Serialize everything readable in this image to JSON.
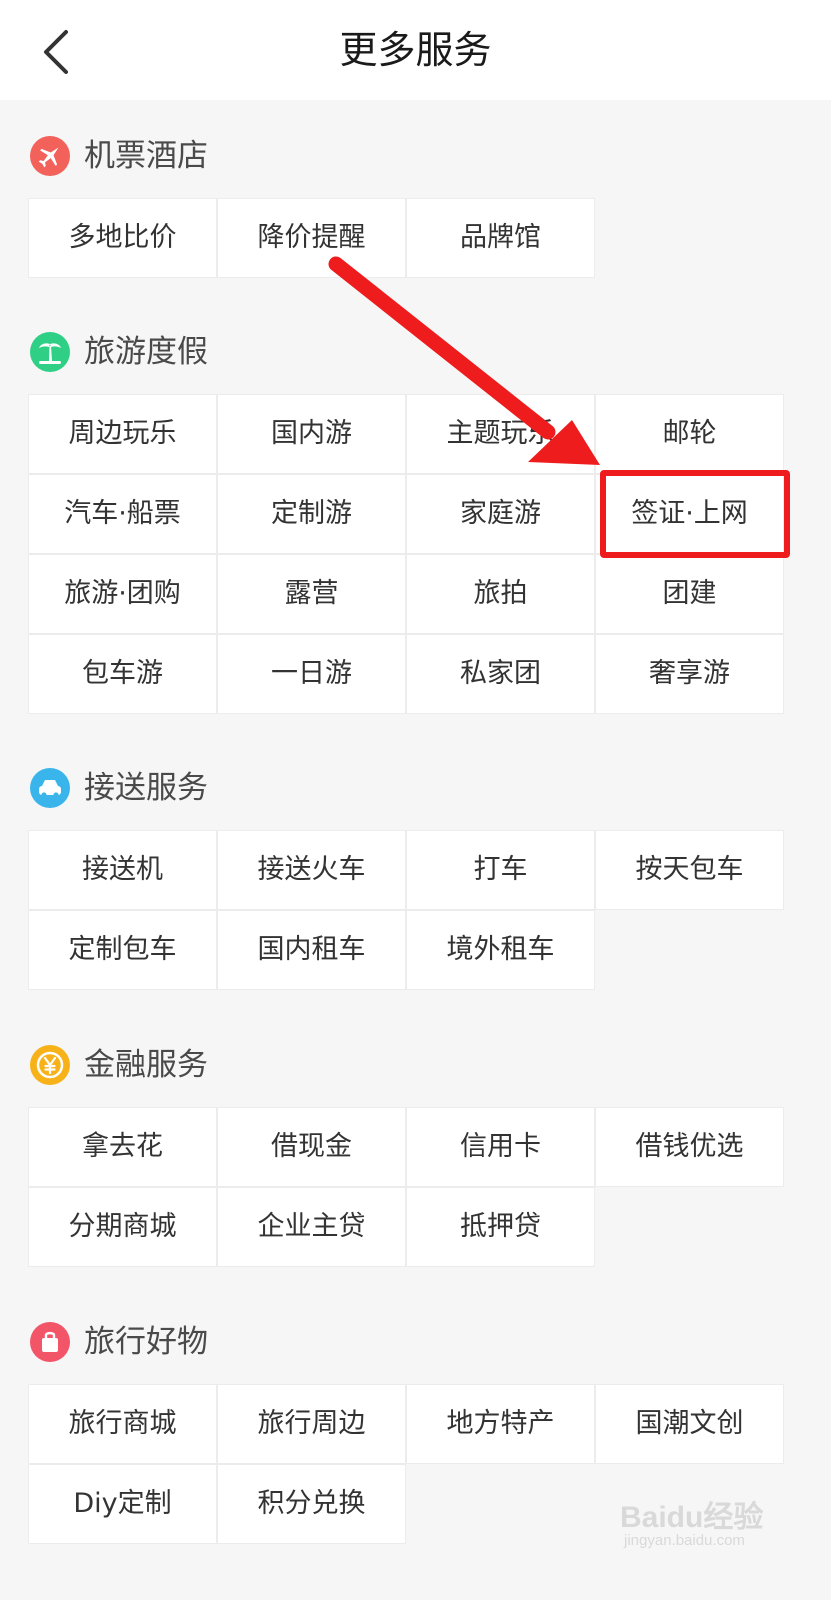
{
  "header": {
    "title": "更多服务"
  },
  "sections": [
    {
      "title": "机票酒店",
      "icon": "airplane-icon",
      "color": "#f2615a",
      "items": [
        "多地比价",
        "降价提醒",
        "品牌馆"
      ]
    },
    {
      "title": "旅游度假",
      "icon": "palm-tree-icon",
      "color": "#2fcf86",
      "items": [
        "周边玩乐",
        "国内游",
        "主题玩乐",
        "邮轮",
        "汽车·船票",
        "定制游",
        "家庭游",
        "签证·上网",
        "旅游·团购",
        "露营",
        "旅拍",
        "团建",
        "包车游",
        "一日游",
        "私家团",
        "奢享游"
      ]
    },
    {
      "title": "接送服务",
      "icon": "car-icon",
      "color": "#3ab5ec",
      "items": [
        "接送机",
        "接送火车",
        "打车",
        "按天包车",
        "定制包车",
        "国内租车",
        "境外租车"
      ]
    },
    {
      "title": "金融服务",
      "icon": "yen-coin-icon",
      "color": "#f7b21a",
      "items": [
        "拿去花",
        "借现金",
        "信用卡",
        "借钱优选",
        "分期商城",
        "企业主贷",
        "抵押贷"
      ]
    },
    {
      "title": "旅行好物",
      "icon": "shopping-bag-icon",
      "color": "#f25468",
      "items": [
        "旅行商城",
        "旅行周边",
        "地方特产",
        "国潮文创",
        "Diy定制",
        "积分兑换"
      ]
    }
  ],
  "watermark": {
    "main": "Baidu经验",
    "sub": "jingyan.baidu.com"
  },
  "annotation": {
    "color": "#ee1c1c"
  }
}
